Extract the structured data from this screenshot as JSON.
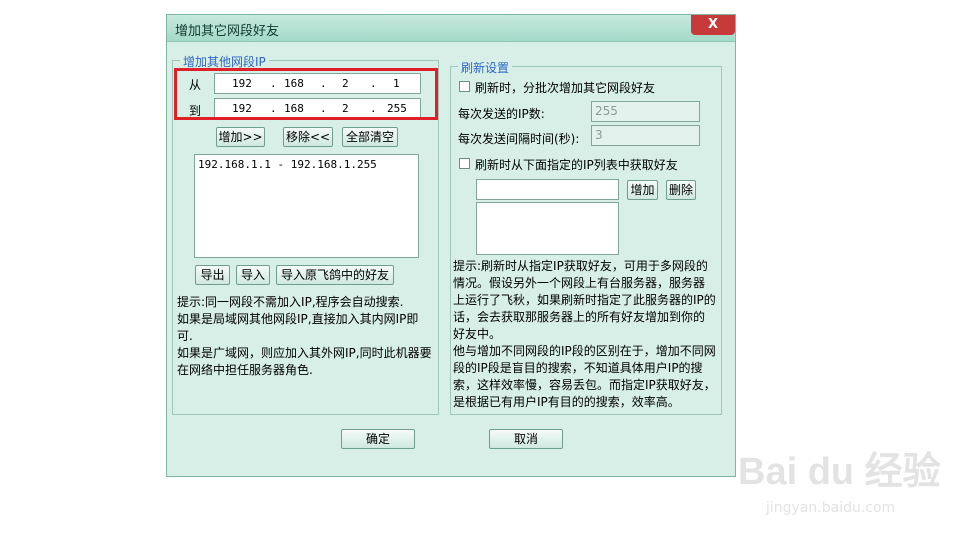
{
  "dialog": {
    "title": "增加其它网段好友",
    "close_label": "X",
    "ok_label": "确定",
    "cancel_label": "取消"
  },
  "left": {
    "legend": "增加其他网段IP",
    "from_label": "从",
    "to_label": "到",
    "from_ip": [
      "192",
      "168",
      "2",
      "1"
    ],
    "to_ip": [
      "192",
      "168",
      "2",
      "255"
    ],
    "dot": ".",
    "add_label": "增加>>",
    "remove_label": "移除<<",
    "clear_label": "全部清空",
    "ranges": [
      "192.168.1.1 - 192.168.1.255"
    ],
    "export_label": "导出",
    "import_label": "导入",
    "import_feige_label": "导入原飞鸽中的好友",
    "hint": [
      "提示:同一网段不需加入IP,程序会自动搜索.",
      "如果是局域网其他网段IP,直接加入其内网IP即",
      "可.",
      "如果是广域网，则应加入其外网IP,同时此机器要",
      "在网络中担任服务器角色."
    ]
  },
  "right": {
    "legend": "刷新设置",
    "batch_checkbox_label": "刷新时，分批次增加其它网段好友",
    "ip_count_label": "每次发送的IP数:",
    "ip_count_value": "255",
    "interval_label": "每次发送间隔时间(秒):",
    "interval_value": "3",
    "list_checkbox_label": "刷新时从下面指定的IP列表中获取好友",
    "add_label": "增加",
    "delete_label": "删除",
    "hint": [
      "提示:刷新时从指定IP获取好友，可用于多网段的",
      "情况。假设另外一个网段上有台服务器，服务器",
      "上运行了飞秋，如果刷新时指定了此服务器的IP的",
      "话，会去获取那服务器上的所有好友增加到你的",
      "好友中。",
      "他与增加不同网段的IP段的区别在于，增加不同网",
      "段的IP段是盲目的搜索，不知道具体用户IP的搜",
      "索，这样效率慢，容易丢包。而指定IP获取好友，",
      "是根据已有用户IP有目的的搜索，效率高。"
    ]
  },
  "watermark": {
    "logo": "Bai du 经验",
    "url": "jingyan.baidu.com"
  },
  "colors": {
    "dialog_bg": "#d7efe7",
    "legend": "#2f66c4",
    "highlight": "#e01f26"
  }
}
